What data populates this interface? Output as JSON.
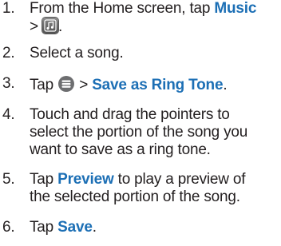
{
  "steps": [
    {
      "number": "1.",
      "before": "From the Home screen, tap ",
      "keyword": "Music",
      "after": " > ",
      "icon": "music-app-icon",
      "end": "."
    },
    {
      "number": "2.",
      "text": "Select a song."
    },
    {
      "number": "3.",
      "before": "Tap ",
      "icon": "menu-list-icon",
      "middle": " > ",
      "keyword": "Save as Ring Tone",
      "end": "."
    },
    {
      "number": "4.",
      "lines": [
        "Touch and drag the pointers to",
        "select the portion of the song you",
        "want to save as a ring tone."
      ]
    },
    {
      "number": "5.",
      "before": "Tap ",
      "keyword": "Preview",
      "after": " to play a preview of",
      "line2": "the selected portion of the song."
    },
    {
      "number": "6.",
      "before": "Tap ",
      "keyword": "Save",
      "end": "."
    }
  ],
  "colors": {
    "text": "#231f20",
    "keyword": "#1c6fb5",
    "icon_gray": "#5a5a5a"
  }
}
